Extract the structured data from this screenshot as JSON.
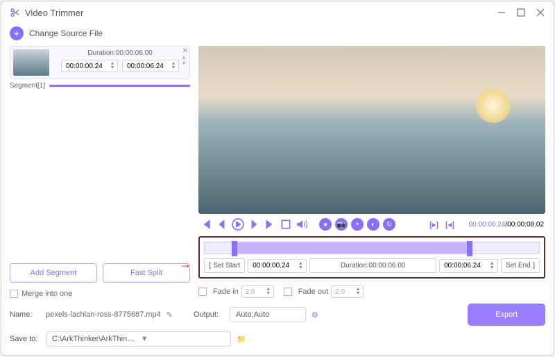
{
  "window": {
    "title": "Video Trimmer"
  },
  "toolbar": {
    "change_source": "Change Source File"
  },
  "segment": {
    "duration_label": "Duration:00:00:06.00",
    "start_time": "00:00:00.24",
    "end_time": "00:00:06.24",
    "label": "Segment[1]"
  },
  "buttons": {
    "add_segment": "Add Segment",
    "fast_split": "Fast Split",
    "export": "Export"
  },
  "merge": {
    "label": "Merge into one"
  },
  "player": {
    "current_time": "00:00:06.24",
    "total_time": "00:00:08.02"
  },
  "trim": {
    "set_start": "Set Start",
    "set_end": "Set End",
    "start_val": "00:00:00.24",
    "end_val": "00:00:06.24",
    "duration_label": "Duration:00:00:06.00"
  },
  "fade": {
    "in_label": "Fade in",
    "out_label": "Fade out",
    "in_val": "2.0",
    "out_val": "2.0"
  },
  "bottom": {
    "name_label": "Name:",
    "name_val": "pexels-lachlan-ross-8775687.mp4",
    "output_label": "Output:",
    "output_val": "Auto;Auto",
    "save_label": "Save to:",
    "save_val": "C:\\ArkThinker\\ArkThink...erter Ultimate\\Trimmer"
  }
}
